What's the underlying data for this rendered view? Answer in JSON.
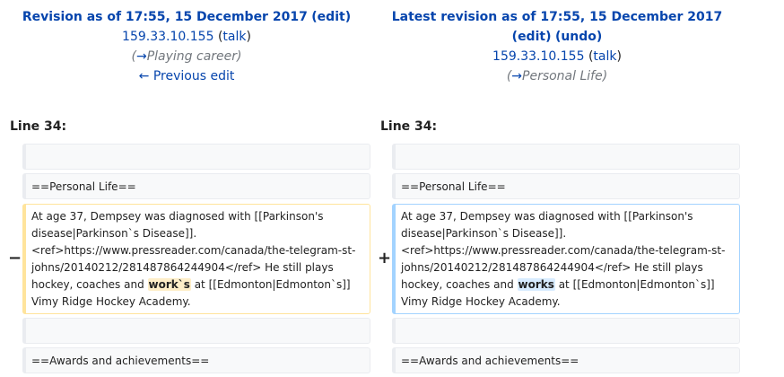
{
  "left": {
    "title_prefix": "Revision as of 17:55, 15 December 2017",
    "edit_label": "edit",
    "user": "159.33.10.155",
    "talk_label": "talk",
    "comment_arrow": "→",
    "comment_section": "Playing career",
    "prev_edit": "← Previous edit",
    "line_label": "Line 34:",
    "context_heading": "==Personal Life==",
    "changed_before": "At age 37, Dempsey was diagnosed with [[Parkinson's disease|Parkinson`s Disease]]. <ref>https://www.pressreader.com/canada/the-telegram-st-johns/20140212/281487864244904</ref> He still plays hockey, coaches and ",
    "changed_word": "work`s",
    "changed_after": " at [[Edmonton|Edmonton`s]] Vimy Ridge Hockey Academy.",
    "context_heading2": "==Awards and achievements=="
  },
  "right": {
    "title_prefix": "Latest revision as of 17:55, 15 December 2017",
    "edit_label": "edit",
    "undo_label": "undo",
    "user": "159.33.10.155",
    "talk_label": "talk",
    "comment_arrow": "→",
    "comment_section": "Personal Life",
    "line_label": "Line 34:",
    "context_heading": "==Personal Life==",
    "changed_before": "At age 37, Dempsey was diagnosed with [[Parkinson's disease|Parkinson`s Disease]]. <ref>https://www.pressreader.com/canada/the-telegram-st-johns/20140212/281487864244904</ref> He still plays hockey, coaches and ",
    "changed_word": "works",
    "changed_after": " at [[Edmonton|Edmonton`s]] Vimy Ridge Hockey Academy.",
    "context_heading2": "==Awards and achievements=="
  },
  "markers": {
    "minus": "−",
    "plus": "+"
  }
}
